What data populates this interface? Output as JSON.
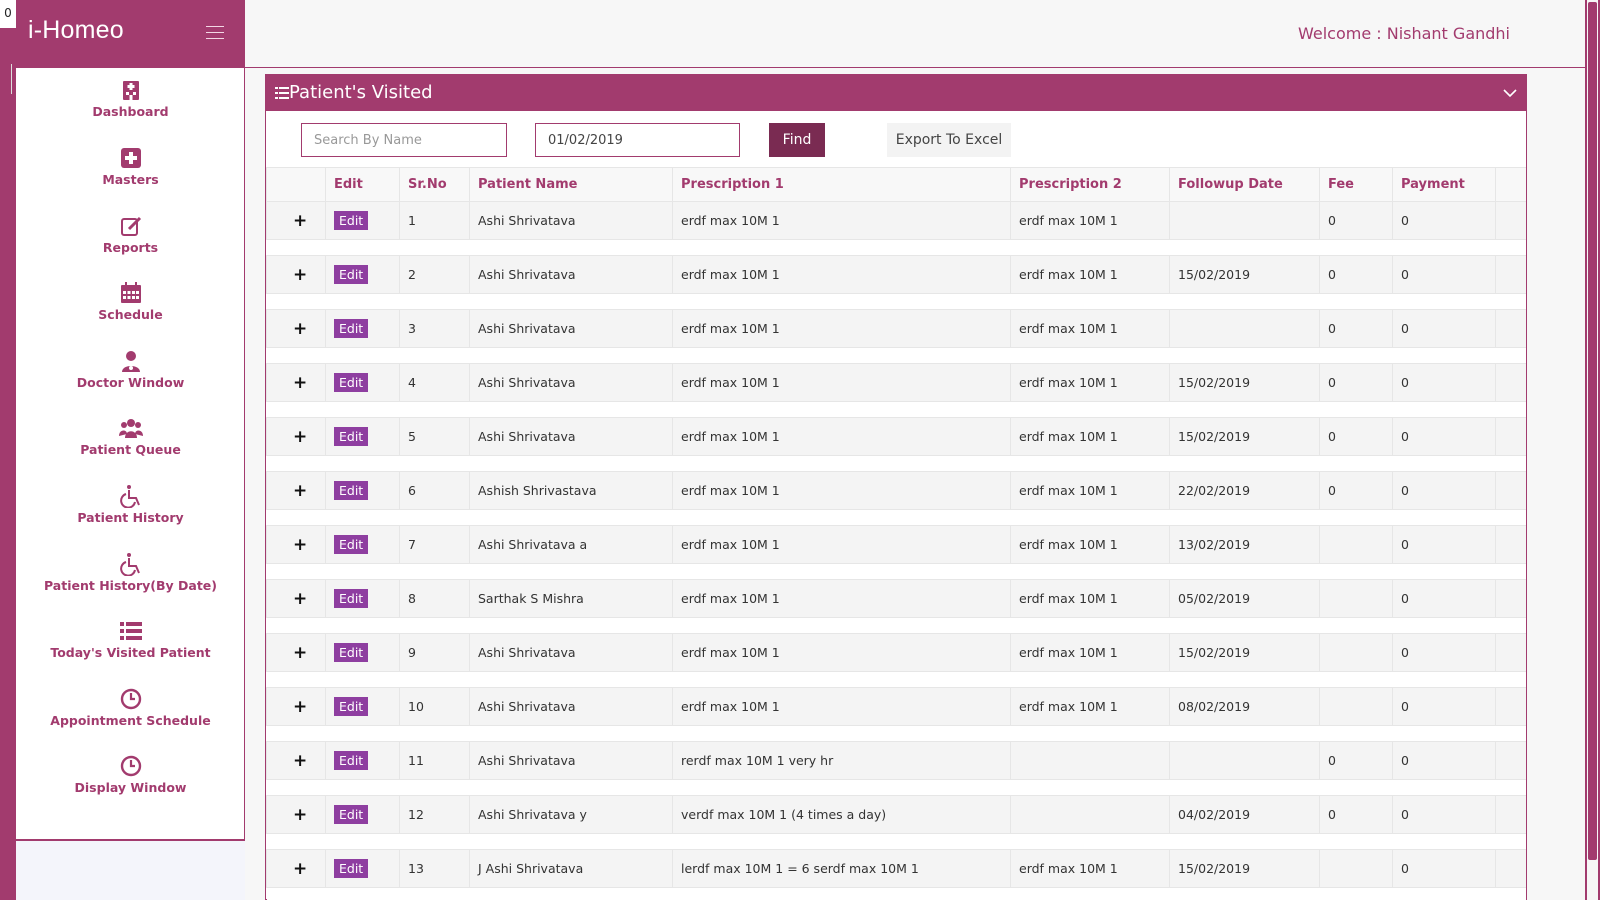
{
  "corner": {
    "counter": "0"
  },
  "brand": {
    "title": "i-Homeo"
  },
  "header": {
    "welcome": "Welcome : Nishant Gandhi"
  },
  "sidebar": {
    "items": [
      {
        "label": "Dashboard",
        "icon": "hospital-icon"
      },
      {
        "label": "Masters",
        "icon": "plus-square-icon"
      },
      {
        "label": "Reports",
        "icon": "edit-icon"
      },
      {
        "label": "Schedule",
        "icon": "calendar-icon"
      },
      {
        "label": "Doctor Window",
        "icon": "doctor-icon"
      },
      {
        "label": "Patient Queue",
        "icon": "users-icon"
      },
      {
        "label": "Patient History",
        "icon": "wheelchair-icon"
      },
      {
        "label": "Patient History(By Date)",
        "icon": "wheelchair-icon"
      },
      {
        "label": "Today's Visited Patient",
        "icon": "list-icon"
      },
      {
        "label": "Appointment Schedule",
        "icon": "clock-icon"
      },
      {
        "label": "Display Window",
        "icon": "clock-icon"
      }
    ]
  },
  "panel": {
    "title": "Patient's Visited",
    "search_placeholder": "Search By Name",
    "date_value": "01/02/2019",
    "find_label": "Find",
    "export_label": "Export To Excel"
  },
  "table": {
    "headers": [
      "",
      "Edit",
      "Sr.No",
      "Patient Name",
      "Prescription 1",
      "Prescription 2",
      "Followup Date",
      "Fee",
      "Payment",
      ""
    ],
    "edit_label": "Edit",
    "expand_label": "+",
    "rows": [
      {
        "srno": "1",
        "name": "Ashi Shrivatava",
        "rx1": "erdf max 10M 1",
        "rx2": "erdf max 10M 1",
        "followup": "",
        "fee": "0",
        "payment": "0"
      },
      {
        "srno": "2",
        "name": "Ashi Shrivatava",
        "rx1": "erdf max 10M 1",
        "rx2": "erdf max 10M 1",
        "followup": "15/02/2019",
        "fee": "0",
        "payment": "0"
      },
      {
        "srno": "3",
        "name": "Ashi Shrivatava",
        "rx1": "erdf max 10M 1",
        "rx2": "erdf max 10M 1",
        "followup": "",
        "fee": "0",
        "payment": "0"
      },
      {
        "srno": "4",
        "name": "Ashi Shrivatava",
        "rx1": "erdf max 10M 1",
        "rx2": "erdf max 10M 1",
        "followup": "15/02/2019",
        "fee": "0",
        "payment": "0"
      },
      {
        "srno": "5",
        "name": "Ashi Shrivatava",
        "rx1": "erdf max 10M 1",
        "rx2": "erdf max 10M 1",
        "followup": "15/02/2019",
        "fee": "0",
        "payment": "0"
      },
      {
        "srno": "6",
        "name": "Ashish Shrivastava",
        "rx1": "erdf max 10M 1",
        "rx2": "erdf max 10M 1",
        "followup": "22/02/2019",
        "fee": "0",
        "payment": "0"
      },
      {
        "srno": "7",
        "name": "Ashi Shrivatava  a",
        "rx1": "erdf max 10M 1",
        "rx2": "erdf max 10M 1",
        "followup": "13/02/2019",
        "fee": "",
        "payment": "0"
      },
      {
        "srno": "8",
        "name": "Sarthak S Mishra",
        "rx1": "erdf max 10M 1",
        "rx2": "erdf max 10M 1",
        "followup": "05/02/2019",
        "fee": "",
        "payment": "0"
      },
      {
        "srno": "9",
        "name": "Ashi Shrivatava",
        "rx1": "erdf max 10M 1",
        "rx2": "erdf max 10M 1",
        "followup": "15/02/2019",
        "fee": "",
        "payment": "0"
      },
      {
        "srno": "10",
        "name": "Ashi Shrivatava",
        "rx1": "erdf max 10M 1",
        "rx2": "erdf max 10M 1",
        "followup": "08/02/2019",
        "fee": "",
        "payment": "0"
      },
      {
        "srno": "11",
        "name": "Ashi Shrivatava",
        "rx1": "rerdf max 10M 1       very hr",
        "rx2": "",
        "followup": "",
        "fee": "0",
        "payment": "0"
      },
      {
        "srno": "12",
        "name": "Ashi Shrivatava  y",
        "rx1": "verdf max 10M 1      (4 times a day)",
        "rx2": "",
        "followup": "04/02/2019",
        "fee": "0",
        "payment": "0"
      },
      {
        "srno": "13",
        "name": "J Ashi Shrivatava",
        "rx1": "lerdf max 10M 1      = 6 serdf max 10M 1",
        "rx2": "erdf max 10M 1",
        "followup": "15/02/2019",
        "fee": "",
        "payment": "0"
      }
    ]
  }
}
